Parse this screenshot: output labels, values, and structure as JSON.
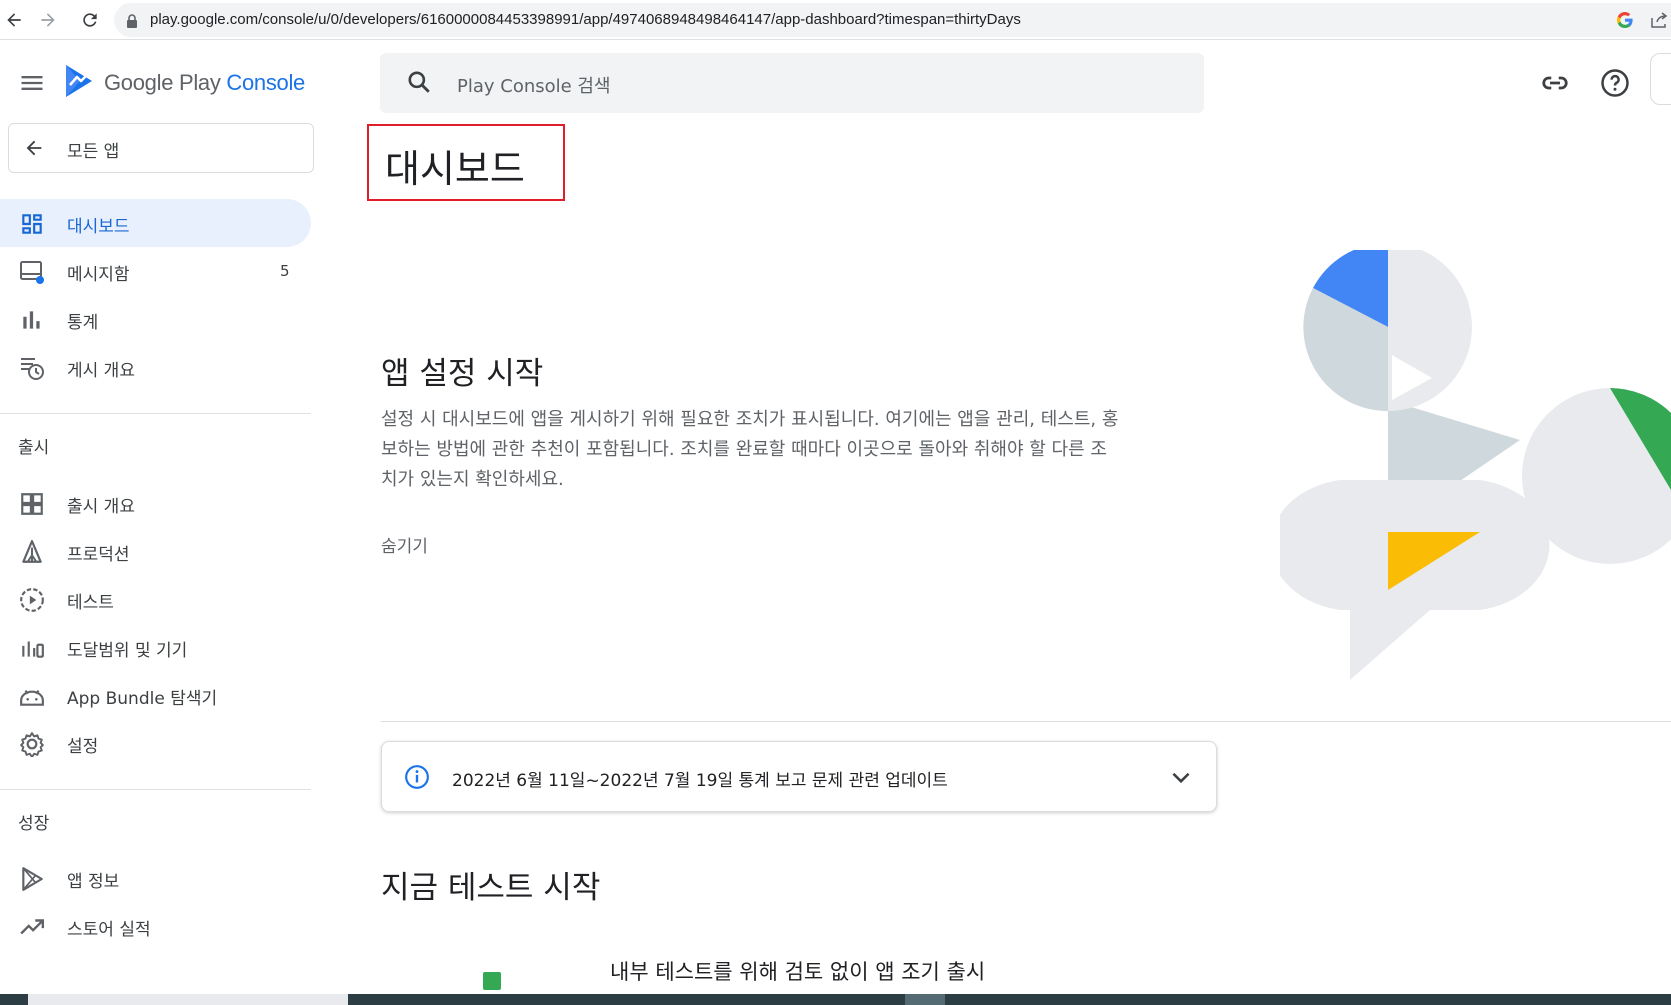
{
  "browser": {
    "url": "play.google.com/console/u/0/developers/6160000084453398991/app/4974068948498464147/app-dashboard?timespan=thirtyDays"
  },
  "brand": {
    "logo_google": "Google Play",
    "logo_console": "Console",
    "colors": {
      "accent": "#1a73e8",
      "active_bg": "#e8f0fe",
      "highlight_border": "#e01e2b"
    }
  },
  "sidebar": {
    "all_apps": "모든 앱",
    "items_top": [
      {
        "label": "대시보드",
        "icon": "dashboard-icon",
        "active": true
      },
      {
        "label": "메시지함",
        "icon": "inbox-icon",
        "count": "5"
      },
      {
        "label": "통계",
        "icon": "bar-chart-icon"
      },
      {
        "label": "게시 개요",
        "icon": "publishing-overview-icon"
      }
    ],
    "release": {
      "header": "출시",
      "items": [
        {
          "label": "출시 개요",
          "icon": "release-overview-icon"
        },
        {
          "label": "프로덕션",
          "icon": "production-icon"
        },
        {
          "label": "테스트",
          "icon": "testing-icon"
        },
        {
          "label": "도달범위 및 기기",
          "icon": "reach-devices-icon"
        },
        {
          "label": "App Bundle 탐색기",
          "icon": "app-bundle-icon"
        },
        {
          "label": "설정",
          "icon": "gear-icon"
        }
      ]
    },
    "growth": {
      "header": "성장",
      "items": [
        {
          "label": "앱 정보",
          "icon": "play-store-icon"
        },
        {
          "label": "스토어 실적",
          "icon": "trending-up-icon"
        }
      ]
    }
  },
  "toolbar": {
    "search_placeholder": "Play Console 검색"
  },
  "main": {
    "page_title": "대시보드",
    "setup": {
      "heading": "앱 설정 시작",
      "description": "설정 시 대시보드에 앱을 게시하기 위해 필요한 조치가 표시됩니다. 여기에는 앱을 관리, 테스트, 홍보하는 방법에 관한 추천이 포함됩니다. 조치를 완료할 때마다 이곳으로 돌아와 취해야 할 다른 조치가 있는지 확인하세요.",
      "hide": "숨기기"
    },
    "notice": "2022년 6월 11일~2022년 7월 19일 통계 보고 문제 관련 업데이트",
    "testing": {
      "heading": "지금 테스트 시작",
      "subtext": "내부 테스트를 위해 검토 없이 앱 조기 출시"
    }
  }
}
